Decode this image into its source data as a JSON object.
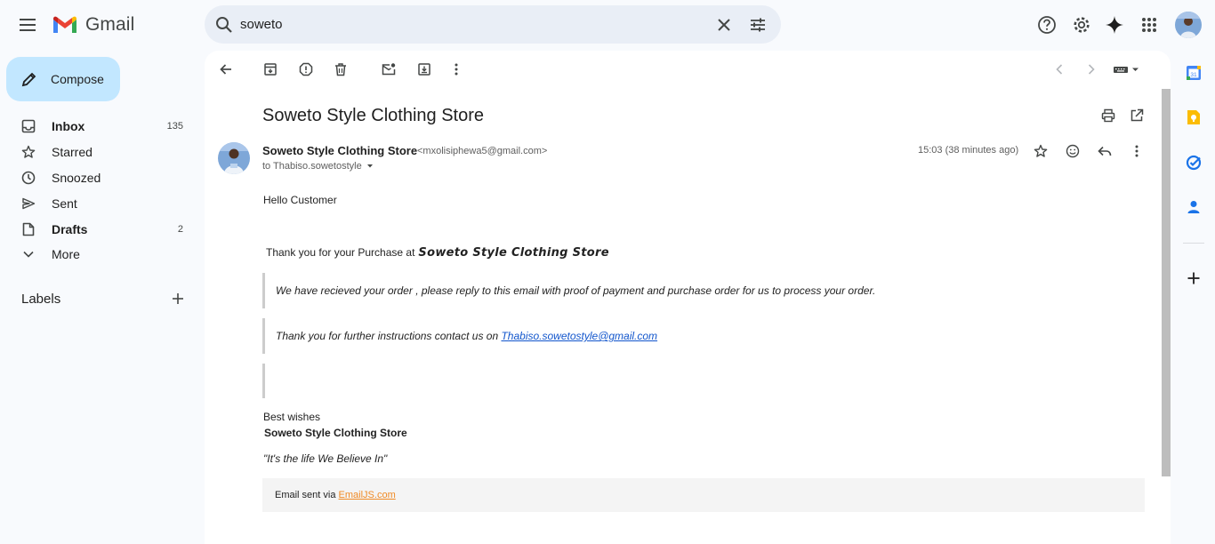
{
  "app": {
    "name": "Gmail"
  },
  "search": {
    "query": "soweto"
  },
  "compose": {
    "label": "Compose"
  },
  "sidebar": {
    "items": [
      {
        "label": "Inbox",
        "count": "135"
      },
      {
        "label": "Starred",
        "count": ""
      },
      {
        "label": "Snoozed",
        "count": ""
      },
      {
        "label": "Sent",
        "count": ""
      },
      {
        "label": "Drafts",
        "count": "2"
      },
      {
        "label": "More",
        "count": ""
      }
    ],
    "labels_header": "Labels"
  },
  "email": {
    "subject": "Soweto Style Clothing Store",
    "sender_name": "Soweto Style Clothing Store",
    "sender_email": "<mxolisiphewa5@gmail.com>",
    "to": "to Thabiso.sowetostyle",
    "time": "15:03 (38 minutes ago)",
    "greeting": "Hello Customer",
    "thanks_prefix": "Thank you for your Purchase at",
    "store_name_styled": "Soweto Style Clothing Store",
    "quote1": "We have recieved your order , please reply to this email with proof of payment and purchase order for us to process your order.",
    "quote2_prefix": "Thank you for further instructions contact us on",
    "quote2_link": "Thabiso.sowetostyle@gmail.com",
    "sign_off": "Best wishes",
    "signature_name": "Soweto Style Clothing Store",
    "slogan": "\"It's the life We Believe In\"",
    "footer_prefix": "Email sent via",
    "footer_link": "EmailJS.com"
  },
  "colors": {
    "compose_bg": "#c2e7ff",
    "search_bg": "#e9eef6",
    "link": "#1155cc",
    "footer_link": "#f08a24"
  }
}
